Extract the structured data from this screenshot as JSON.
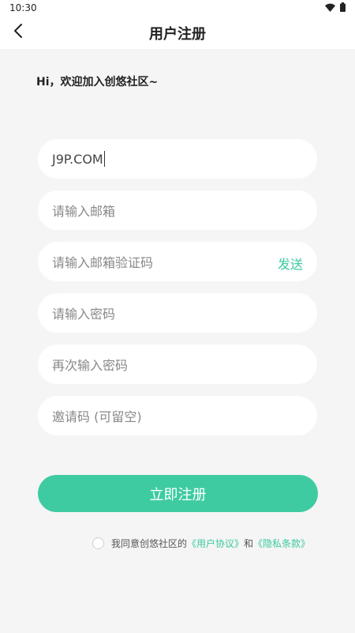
{
  "status": {
    "time": "10:30"
  },
  "header": {
    "title": "用户注册"
  },
  "greeting": "Hi，欢迎加入创悠社区~",
  "form": {
    "username_value": "J9P.COM",
    "email_placeholder": "请输入邮箱",
    "email_code_placeholder": "请输入邮箱验证码",
    "send_label": "发送",
    "password_placeholder": "请输入密码",
    "confirm_password_placeholder": "再次输入密码",
    "invite_placeholder": "邀请码 (可留空)"
  },
  "register_label": "立即注册",
  "agreement": {
    "prefix": "我同意创悠社区的",
    "user_agreement": "《用户协议》",
    "and": "和",
    "privacy_policy": "《隐私条款》"
  },
  "colors": {
    "accent": "#3ecba2",
    "background": "#f5f5f5"
  }
}
